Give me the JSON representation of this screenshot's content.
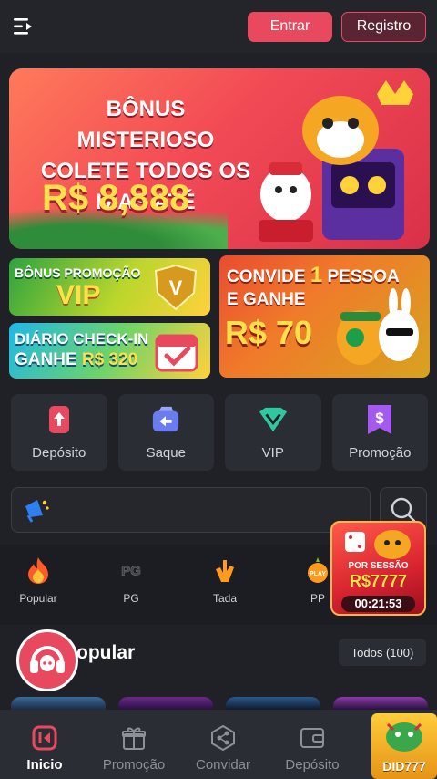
{
  "header": {
    "login_label": "Entrar",
    "register_label": "Registro"
  },
  "banner": {
    "line1": "BÔNUS MISTERIOSO",
    "line2": "COLETE TODOS OS",
    "line3": "DIAS ATÉ",
    "amount": "R$ 8,888"
  },
  "promos": {
    "vip": {
      "line1": "BÔNUS PROMOÇÃO",
      "line2": "VIP"
    },
    "checkin": {
      "line1": "DIÁRIO CHECK-IN",
      "line2_prefix": "GANHE ",
      "line2_amount": "R$ 320"
    },
    "invite": {
      "line1_prefix": "CONVIDE ",
      "line1_num": "1",
      "line1_suffix": " PESSOA",
      "line2": "E GANHE",
      "amount": "R$ 70"
    }
  },
  "actions": [
    {
      "label": "Depósito",
      "icon": "deposit-icon",
      "color": "#e8495f"
    },
    {
      "label": "Saque",
      "icon": "withdraw-icon",
      "color": "#6a7cf0"
    },
    {
      "label": "VIP",
      "icon": "vip-diamond-icon",
      "color": "#2fc7a0"
    },
    {
      "label": "Promoção",
      "icon": "promotion-icon",
      "color": "#a45af0"
    }
  ],
  "categories": [
    {
      "label": "Popular",
      "icon": "fire-icon"
    },
    {
      "label": "PG",
      "icon": "pg-logo-icon"
    },
    {
      "label": "Tada",
      "icon": "tada-icon"
    },
    {
      "label": "PP",
      "icon": "pp-play-icon"
    }
  ],
  "section": {
    "title": "Popular",
    "all_label": "Todos (100)"
  },
  "floating_promo": {
    "label": "POR SESSÃO",
    "amount": "R$7777",
    "timer": "00:21:53"
  },
  "bottom_nav": [
    {
      "label": "Inicio",
      "icon": "home-icon",
      "active": true
    },
    {
      "label": "Promoção",
      "icon": "gift-icon",
      "active": false
    },
    {
      "label": "Convidar",
      "icon": "share-icon",
      "active": false
    },
    {
      "label": "Depósito",
      "icon": "wallet-icon",
      "active": false
    }
  ],
  "nav_badge": {
    "label": "DID777"
  },
  "colors": {
    "accent": "#e8495f",
    "background": "#1f2127",
    "card": "#2a2d34"
  }
}
